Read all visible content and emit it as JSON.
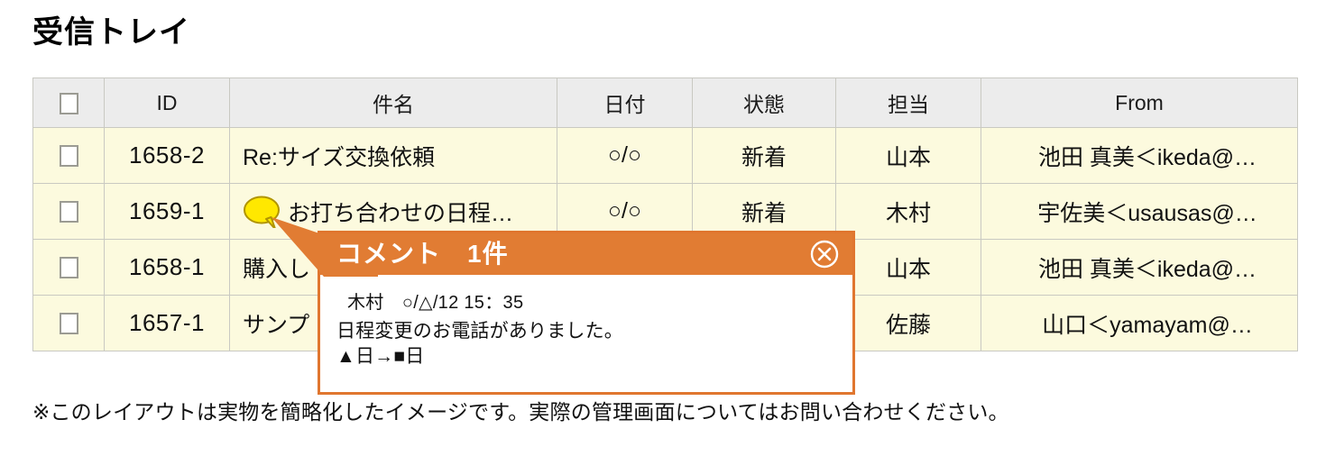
{
  "page": {
    "title": "受信トレイ",
    "footer_note": "※このレイアウトは実物を簡略化したイメージです。実際の管理画面についてはお問い合わせください。"
  },
  "colors": {
    "accent_orange": "#e17c33",
    "popup_border": "#e0762f",
    "row_bg": "#fcfade",
    "header_bg": "#ececec",
    "bubble_yellow": "#ffe800",
    "bubble_border": "#b89b00"
  },
  "table": {
    "columns": [
      {
        "key": "check",
        "label": "",
        "icon": "checkbox-icon"
      },
      {
        "key": "id",
        "label": "ID"
      },
      {
        "key": "subject",
        "label": "件名"
      },
      {
        "key": "date",
        "label": "日付"
      },
      {
        "key": "status",
        "label": "状態"
      },
      {
        "key": "owner",
        "label": "担当"
      },
      {
        "key": "from",
        "label": "From"
      }
    ],
    "rows": [
      {
        "id": "1658-2",
        "subject": "Re:サイズ交換依頼",
        "has_comment_badge": false,
        "date": "○/○",
        "status": "新着",
        "owner": "山本",
        "from": "池田 真美＜ikeda@…"
      },
      {
        "id": "1659-1",
        "subject": "お打ち合わせの日程…",
        "has_comment_badge": true,
        "date": "○/○",
        "status": "新着",
        "owner": "木村",
        "from": "宇佐美＜usausas@…"
      },
      {
        "id": "1658-1",
        "subject": "購入し",
        "has_comment_badge": false,
        "date": "",
        "status": "",
        "owner": "山本",
        "from": "池田 真美＜ikeda@…"
      },
      {
        "id": "1657-1",
        "subject": "サンプ",
        "has_comment_badge": false,
        "date": "",
        "status": "",
        "owner": "佐藤",
        "from": "山口＜yamayam@…"
      }
    ]
  },
  "comment_popup": {
    "title": "コメント　1件",
    "close_icon": "close-circle-icon",
    "comment": {
      "author": "木村",
      "timestamp": "○/△/12 15：35",
      "meta": "木村　○/△/12 15：35",
      "lines": [
        "日程変更のお電話がありました。",
        "▲日→■日"
      ]
    }
  }
}
